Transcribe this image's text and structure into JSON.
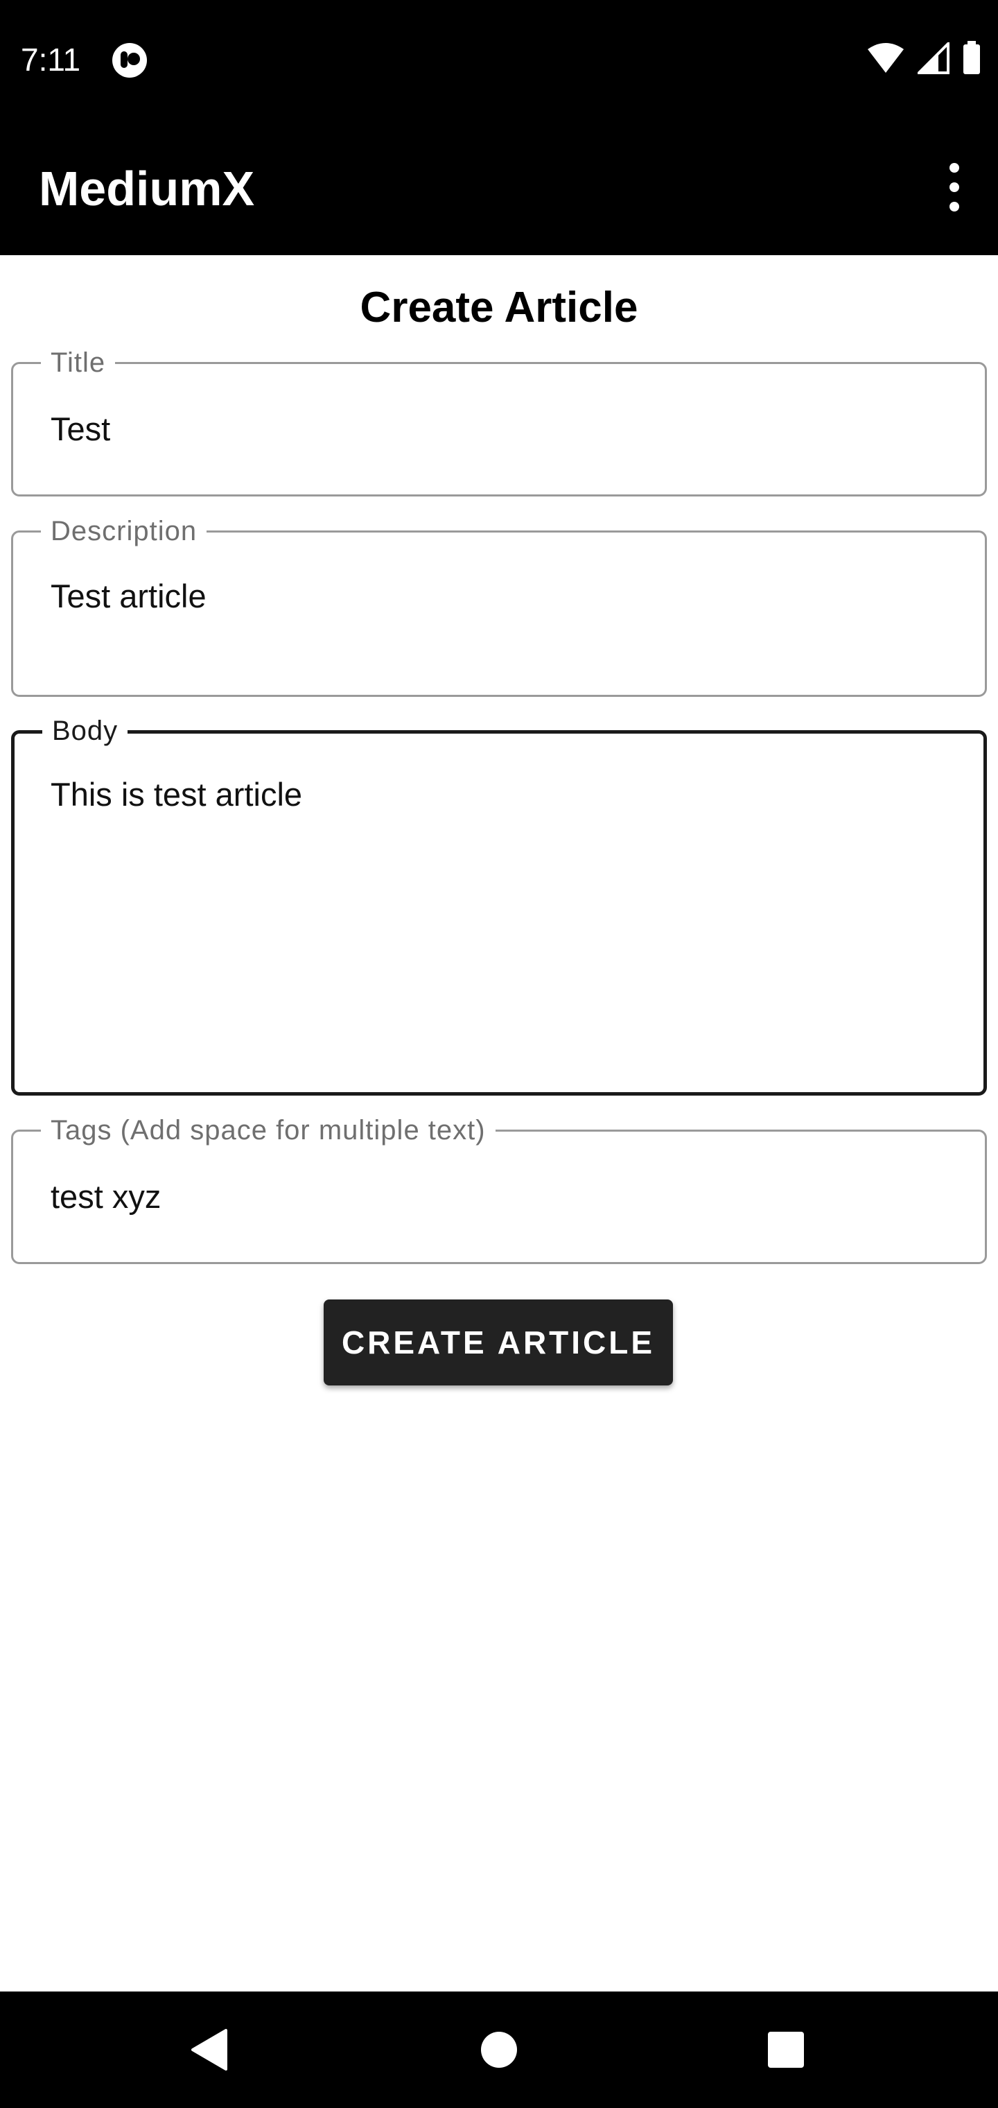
{
  "status_bar": {
    "time": "7:11",
    "icons": [
      "app-notification-icon",
      "wifi-icon",
      "cellular-signal-icon",
      "battery-icon"
    ]
  },
  "app_bar": {
    "title": "MediumX",
    "menu_icon": "more-vert-icon"
  },
  "form": {
    "heading": "Create Article",
    "fields": [
      {
        "label": "Title",
        "value": "Test"
      },
      {
        "label": "Description",
        "value": "Test article"
      },
      {
        "label": "Body",
        "value": "This is test article"
      },
      {
        "label": "Tags (Add space for multiple text)",
        "value": "test xyz"
      }
    ],
    "focused_field": "Body",
    "submit_label": "CREATE ARTICLE"
  },
  "nav_bar": {
    "buttons": [
      "back-icon",
      "home-icon",
      "recents-icon"
    ]
  },
  "colors": {
    "bar_background": "#000000",
    "page_background": "#ffffff",
    "button_background": "#222222",
    "field_border": "#9a9a9a",
    "focused_border": "#1a1a1a"
  }
}
